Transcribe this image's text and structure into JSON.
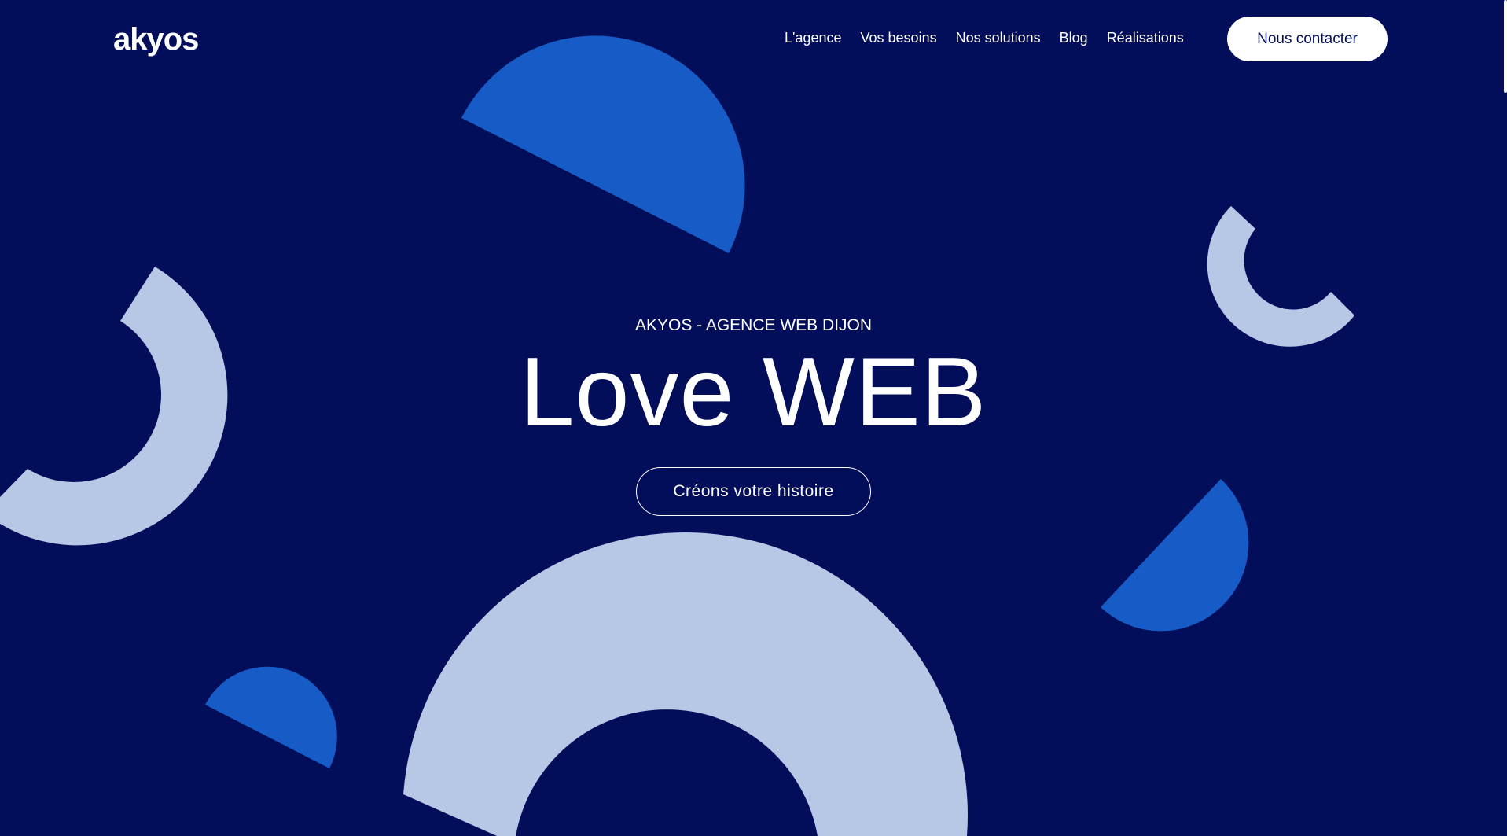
{
  "header": {
    "logo": "akyos",
    "nav": [
      {
        "label": "L'agence"
      },
      {
        "label": "Vos besoins"
      },
      {
        "label": "Nos solutions"
      },
      {
        "label": "Blog"
      },
      {
        "label": "Réalisations"
      }
    ],
    "contact_label": "Nous contacter"
  },
  "hero": {
    "eyebrow": "AKYOS - AGENCE WEB DIJON",
    "title": "Love WEB",
    "cta_label": "Créons votre histoire"
  },
  "colors": {
    "background": "#030e5a",
    "shape_light": "#b6c8e6",
    "shape_blue": "#175cc6",
    "text": "#ffffff"
  }
}
